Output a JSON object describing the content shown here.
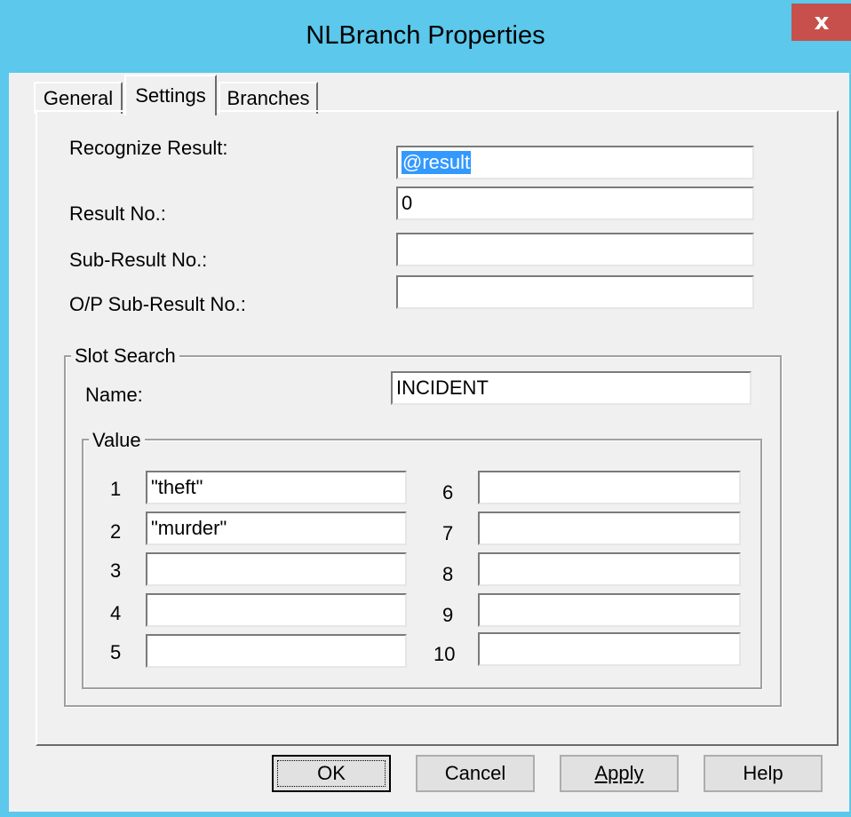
{
  "window": {
    "title": "NLBranch Properties",
    "close_label": "x"
  },
  "tabs": [
    {
      "label": "General",
      "active": false
    },
    {
      "label": "Settings",
      "active": true
    },
    {
      "label": "Branches",
      "active": false
    }
  ],
  "fields": {
    "recognize_result": {
      "label": "Recognize Result:",
      "value": "@result"
    },
    "result_no": {
      "label": "Result No.:",
      "value": "0"
    },
    "sub_result_no": {
      "label": "Sub-Result No.:",
      "value": ""
    },
    "op_sub_result_no": {
      "label": "O/P Sub-Result No.:",
      "value": ""
    }
  },
  "slot_search": {
    "title": "Slot Search",
    "name_label": "Name:",
    "name_value": "INCIDENT",
    "value_group": {
      "title": "Value",
      "rows": [
        {
          "index": "1",
          "value": "\"theft\""
        },
        {
          "index": "2",
          "value": "\"murder\""
        },
        {
          "index": "3",
          "value": ""
        },
        {
          "index": "4",
          "value": ""
        },
        {
          "index": "5",
          "value": ""
        },
        {
          "index": "6",
          "value": ""
        },
        {
          "index": "7",
          "value": ""
        },
        {
          "index": "8",
          "value": ""
        },
        {
          "index": "9",
          "value": ""
        },
        {
          "index": "10",
          "value": ""
        }
      ]
    }
  },
  "buttons": {
    "ok": "OK",
    "cancel": "Cancel",
    "apply": "Apply",
    "help": "Help"
  },
  "colors": {
    "titlebar": "#5bc8ec",
    "close_button": "#c7504c",
    "dialog_face": "#f0f0f0",
    "selection": "#3399ff"
  }
}
